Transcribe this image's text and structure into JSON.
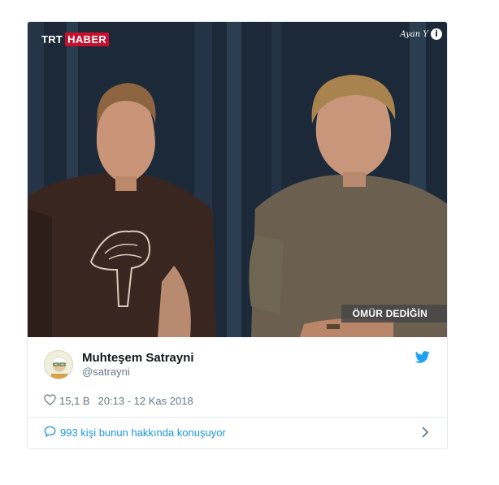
{
  "media": {
    "channel_logo": "TRT",
    "channel_logo_accent": "HABER",
    "corner_mark": "Ayan Y",
    "lower_third": "ÖMÜR DEDİĞİN"
  },
  "tweet": {
    "display_name": "Muhteşem Satrayni",
    "handle": "@satrayni",
    "likes": "15,1 B",
    "timestamp": "20:13 - 12 Kas 2018",
    "conversation": "993 kişi bunun hakkında konuşuyor"
  },
  "icons": {
    "platform": "twitter-bird-icon",
    "like": "heart-icon",
    "reply": "speech-bubble-icon",
    "expand": "chevron-right-icon",
    "info": "info-icon"
  },
  "colors": {
    "twitter_blue": "#1da1f2",
    "link_blue": "#1b95e0",
    "trt_red": "#c8102e"
  }
}
